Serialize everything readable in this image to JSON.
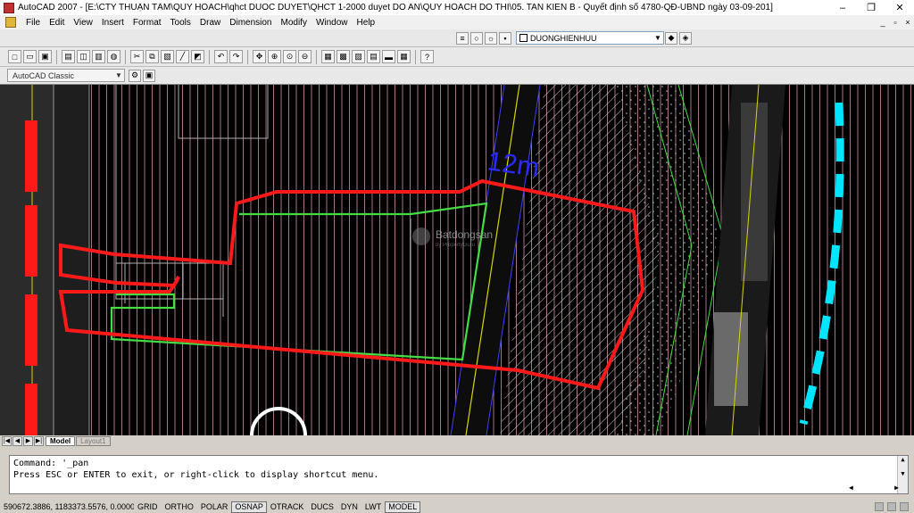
{
  "window": {
    "title": "AutoCAD 2007 - [E:\\CTY THUẬN TÂM\\QUY HOACH\\qhct DUOC DUYET\\QHCT 1-2000 duyet DO AN\\QUY HOACH DO THI\\05. TAN KIEN B - Quyết định số 4780-QĐ-UBND ngày 03-09-201]",
    "minimize": "–",
    "restore": "❐",
    "close": "✕"
  },
  "menu": {
    "items": [
      "File",
      "Edit",
      "View",
      "Insert",
      "Format",
      "Tools",
      "Draw",
      "Dimension",
      "Modify",
      "Window",
      "Help"
    ],
    "mdi": [
      "_",
      "▫",
      "×"
    ]
  },
  "layer": {
    "current": "DUONGHIENHUU"
  },
  "workspace": {
    "current": "AutoCAD Classic"
  },
  "drawing": {
    "dimension_label": "12m",
    "watermark": "Batdongsan",
    "watermark_sub": "by PropertyGuru"
  },
  "tabs": {
    "model": "Model",
    "layout": "Layout1"
  },
  "command": {
    "line1": "Command: '_pan",
    "line2": "Press ESC or ENTER to exit, or right-click to display shortcut menu."
  },
  "status": {
    "coords": "590672.3886, 1183373.5576, 0.0000",
    "toggles": [
      {
        "label": "GRID",
        "on": false
      },
      {
        "label": "ORTHO",
        "on": false
      },
      {
        "label": "POLAR",
        "on": false
      },
      {
        "label": "OSNAP",
        "on": true
      },
      {
        "label": "OTRACK",
        "on": false
      },
      {
        "label": "DUCS",
        "on": false
      },
      {
        "label": "DYN",
        "on": false
      },
      {
        "label": "LWT",
        "on": false
      },
      {
        "label": "MODEL",
        "on": true
      }
    ]
  },
  "colors": {
    "red_boundary": "#ff1a1a",
    "green_boundary": "#44dd44",
    "cyan_line": "#00e5ff",
    "blue_text": "#2a2aff",
    "grid_lines": "#d8a0b0"
  }
}
